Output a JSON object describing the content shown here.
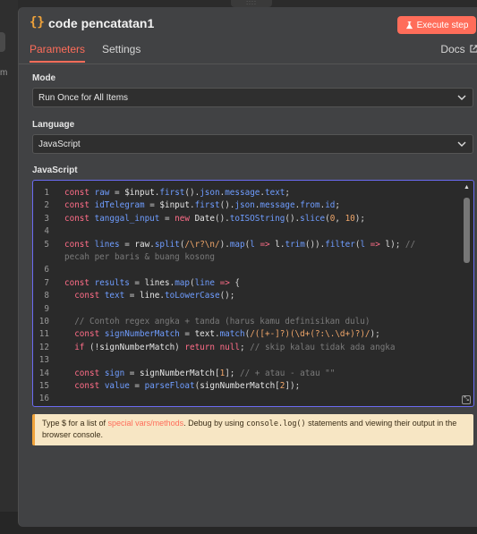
{
  "node": {
    "icon": "code-braces-icon",
    "icon_glyph": "{}",
    "title": "code pencatatan1",
    "execute_label": "Execute step",
    "execute_icon": "flask-icon"
  },
  "tabs": {
    "parameters": "Parameters",
    "settings": "Settings",
    "docs": "Docs"
  },
  "fields": {
    "mode_label": "Mode",
    "mode_value": "Run Once for All Items",
    "language_label": "Language",
    "language_value": "JavaScript",
    "code_label": "JavaScript"
  },
  "code_lines": [
    {
      "n": "1",
      "html": "<span class='kw'>const</span> <span class='fn'>raw</span> = <span class='var'>$input</span>.<span class='fn'>first</span>().<span class='fn'>json</span>.<span class='fn'>message</span>.<span class='fn'>text</span>;"
    },
    {
      "n": "2",
      "html": "<span class='kw'>const</span> <span class='fn'>idTelegram</span> = <span class='var'>$input</span>.<span class='fn'>first</span>().<span class='fn'>json</span>.<span class='fn'>message</span>.<span class='fn'>from</span>.<span class='fn'>id</span>;"
    },
    {
      "n": "3",
      "html": "<span class='kw'>const</span> <span class='fn'>tanggal_input</span> = <span class='kw'>new</span> <span class='var'>Date</span>().<span class='fn'>toISOString</span>().<span class='fn'>slice</span>(<span class='str'>0</span>, <span class='str'>10</span>);"
    },
    {
      "n": "4",
      "html": ""
    },
    {
      "n": "5",
      "html": "<span class='kw'>const</span> <span class='fn'>lines</span> = <span class='var'>raw</span>.<span class='fn'>split</span>(<span class='str'>/\\r?\\n/</span>).<span class='fn'>map</span>(<span class='fn'>l</span> <span class='kw'>=&gt;</span> <span class='var'>l</span>.<span class='fn'>trim</span>()).<span class='fn'>filter</span>(<span class='fn'>l</span> <span class='kw'>=&gt;</span> <span class='var'>l</span>); <span class='cm'>//</span>"
    },
    {
      "n": "",
      "html": "<span class='cm'>pecah per baris &amp; buang kosong</span>"
    },
    {
      "n": "6",
      "html": ""
    },
    {
      "n": "7",
      "html": "<span class='kw'>const</span> <span class='fn'>results</span> = <span class='var'>lines</span>.<span class='fn'>map</span>(<span class='fn'>line</span> <span class='kw'>=&gt;</span> {"
    },
    {
      "n": "8",
      "html": "  <span class='kw'>const</span> <span class='fn'>text</span> = <span class='var'>line</span>.<span class='fn'>toLowerCase</span>();"
    },
    {
      "n": "9",
      "html": ""
    },
    {
      "n": "10",
      "html": "  <span class='cm'>// Contoh regex angka + tanda (harus kamu definisikan dulu)</span>"
    },
    {
      "n": "11",
      "html": "  <span class='kw'>const</span> <span class='fn'>signNumberMatch</span> = <span class='var'>text</span>.<span class='fn'>match</span>(<span class='str'>/([+-]?)(\\d+(?:\\.\\d+)?)/</span>);"
    },
    {
      "n": "12",
      "html": "  <span class='kw'>if</span> (!<span class='var'>signNumberMatch</span>) <span class='kw'>return</span> <span class='kw'>null</span>; <span class='cm'>// skip kalau tidak ada angka</span>"
    },
    {
      "n": "13",
      "html": ""
    },
    {
      "n": "14",
      "html": "  <span class='kw'>const</span> <span class='fn'>sign</span> = <span class='var'>signNumberMatch</span>[<span class='str'>1</span>]; <span class='cm'>// + atau - atau \"\"</span>"
    },
    {
      "n": "15",
      "html": "  <span class='kw'>const</span> <span class='fn'>value</span> = <span class='fn'>parseFloat</span>(<span class='var'>signNumberMatch</span>[<span class='str'>2</span>]);"
    },
    {
      "n": "16",
      "html": ""
    }
  ],
  "hint": {
    "prefix": "Type $ for a list of ",
    "link": "special vars/methods",
    "middle": ". Debug by using ",
    "code": "console.log()",
    "suffix": " statements and viewing their output in the browser console."
  },
  "background": {
    "left_letter": "m"
  },
  "colors": {
    "accent": "#ff6d5a",
    "panel": "#414244",
    "editor_border": "#6b6bf0",
    "hint_bg": "#f7e6c4"
  }
}
